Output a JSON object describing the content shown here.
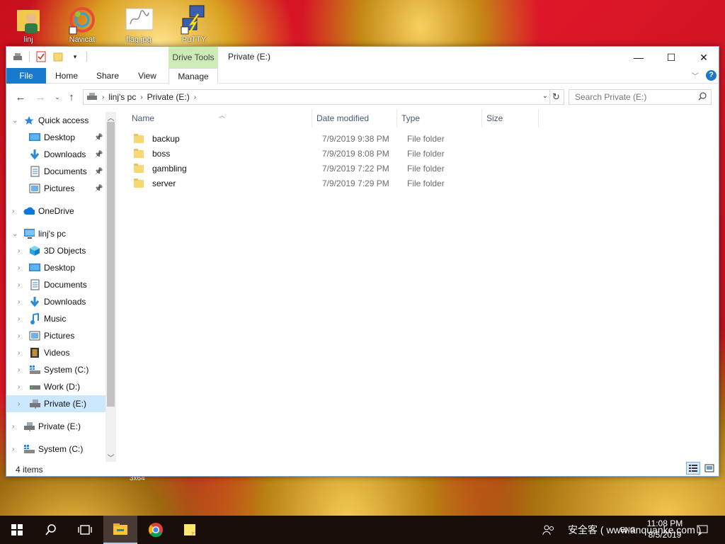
{
  "desktop": {
    "icons": [
      {
        "name": "user-folder-icon",
        "label": "linj"
      },
      {
        "name": "navicat-icon",
        "label": "Navicat"
      },
      {
        "name": "flag-file-icon",
        "label": "flag.jpg"
      },
      {
        "name": "putty-icon",
        "label": "PuTTY"
      }
    ],
    "under_window_text": "3x64"
  },
  "window": {
    "title": "Private (E:)",
    "contextual_group": "Drive Tools",
    "controls": {
      "minimize": "—",
      "maximize": "☐",
      "close": "✕"
    },
    "ribbon_tabs": [
      {
        "label": "File"
      },
      {
        "label": "Home"
      },
      {
        "label": "Share"
      },
      {
        "label": "View"
      },
      {
        "label": "Manage"
      }
    ],
    "address": {
      "crumbs": [
        "linj's pc",
        "Private (E:)"
      ]
    },
    "search": {
      "placeholder": "Search Private (E:)"
    },
    "nav": [
      {
        "label": "Quick access",
        "icon": "star-icon",
        "level": 0,
        "expanded": true
      },
      {
        "label": "Desktop",
        "icon": "desktop-icon",
        "level": 1,
        "pinned": true
      },
      {
        "label": "Downloads",
        "icon": "download-arrow-icon",
        "level": 1,
        "pinned": true
      },
      {
        "label": "Documents",
        "icon": "documents-icon",
        "level": 1,
        "pinned": true
      },
      {
        "label": "Pictures",
        "icon": "pictures-icon",
        "level": 1,
        "pinned": true
      },
      {
        "label": "OneDrive",
        "icon": "cloud-icon",
        "level": 0,
        "expanded": false
      },
      {
        "label": "linj's pc",
        "icon": "computer-icon",
        "level": 0,
        "expanded": true
      },
      {
        "label": "3D Objects",
        "icon": "cube-icon",
        "level": 1
      },
      {
        "label": "Desktop",
        "icon": "desktop-icon",
        "level": 1
      },
      {
        "label": "Documents",
        "icon": "documents-icon",
        "level": 1
      },
      {
        "label": "Downloads",
        "icon": "download-arrow-icon",
        "level": 1
      },
      {
        "label": "Music",
        "icon": "music-note-icon",
        "level": 1
      },
      {
        "label": "Pictures",
        "icon": "pictures-icon",
        "level": 1
      },
      {
        "label": "Videos",
        "icon": "film-icon",
        "level": 1
      },
      {
        "label": "System (C:)",
        "icon": "system-drive-icon",
        "level": 1
      },
      {
        "label": "Work (D:)",
        "icon": "drive-icon",
        "level": 1
      },
      {
        "label": "Private (E:)",
        "icon": "network-drive-icon",
        "level": 1,
        "selected": true
      },
      {
        "label": "Private (E:)",
        "icon": "network-drive-icon",
        "level": 0
      },
      {
        "label": "System (C:)",
        "icon": "system-drive-icon",
        "level": 0
      }
    ],
    "columns": [
      "Name",
      "Date modified",
      "Type",
      "Size"
    ],
    "files": [
      {
        "name": "backup",
        "date": "7/9/2019 9:38 PM",
        "type": "File folder",
        "size": ""
      },
      {
        "name": "boss",
        "date": "7/9/2019 8:08 PM",
        "type": "File folder",
        "size": ""
      },
      {
        "name": "gambling",
        "date": "7/9/2019 7:22 PM",
        "type": "File folder",
        "size": ""
      },
      {
        "name": "server",
        "date": "7/9/2019 7:29 PM",
        "type": "File folder",
        "size": ""
      }
    ],
    "status": "4 items"
  },
  "taskbar": {
    "apps": [
      {
        "name": "start-icon"
      },
      {
        "name": "search-icon"
      },
      {
        "name": "task-view-icon"
      },
      {
        "name": "file-explorer-icon",
        "active": true
      },
      {
        "name": "chrome-icon"
      },
      {
        "name": "sticky-notes-icon"
      }
    ],
    "lang": "ENG",
    "time": "11:08 PM",
    "date": "8/5/2019",
    "watermark": "安全客 ( www.anquanke.com )"
  },
  "colors": {
    "accent": "#1979ca",
    "selection": "#cce8ff",
    "drive_tools": "#cdebb6",
    "folder": "#f8d775"
  }
}
